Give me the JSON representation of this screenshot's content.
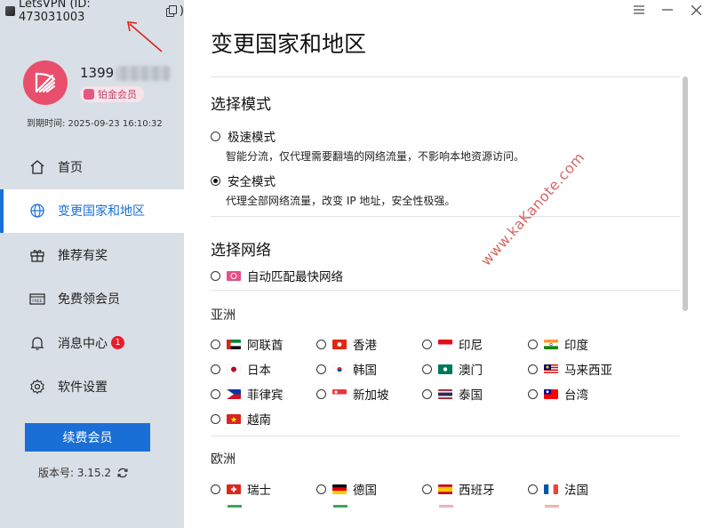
{
  "app": {
    "title": "LetsVPN (ID: 473031003",
    "title_suffix": ")"
  },
  "user": {
    "phone_visible": "1399",
    "badge": "铂金会员",
    "expire": "到期时间: 2025-09-23 16:10:32"
  },
  "nav": [
    {
      "label": "首页",
      "icon": "home-icon"
    },
    {
      "label": "变更国家和地区",
      "icon": "globe-icon",
      "active": true
    },
    {
      "label": "推荐有奖",
      "icon": "gift-icon"
    },
    {
      "label": "免费领会员",
      "icon": "free-ticket-icon"
    },
    {
      "label": "消息中心",
      "icon": "bell-icon",
      "badge": "1"
    },
    {
      "label": "软件设置",
      "icon": "gear-icon"
    }
  ],
  "renew_button": "续费会员",
  "version": "版本号:  3.15.2",
  "page_title": "变更国家和地区",
  "mode": {
    "title": "选择模式",
    "options": [
      {
        "label": "极速模式",
        "desc": "智能分流，仅代理需要翻墙的网络流量，不影响本地资源访问。",
        "checked": false
      },
      {
        "label": "安全模式",
        "desc": "代理全部网络流量，改变 IP 地址，安全性极强。",
        "checked": true
      }
    ]
  },
  "network": {
    "title": "选择网络",
    "auto": "自动匹配最快网络"
  },
  "regions": {
    "asia": "亚洲",
    "europe": "欧洲"
  },
  "asia_countries": [
    {
      "name": "阿联酋",
      "flag": "uae"
    },
    {
      "name": "香港",
      "flag": "hk"
    },
    {
      "name": "印尼",
      "flag": "id"
    },
    {
      "name": "印度",
      "flag": "in"
    },
    {
      "name": "日本",
      "flag": "jp"
    },
    {
      "name": "韩国",
      "flag": "kr"
    },
    {
      "name": "澳门",
      "flag": "mo"
    },
    {
      "name": "马来西亚",
      "flag": "my"
    },
    {
      "name": "菲律宾",
      "flag": "ph"
    },
    {
      "name": "新加坡",
      "flag": "sg"
    },
    {
      "name": "泰国",
      "flag": "th"
    },
    {
      "name": "台湾",
      "flag": "tw"
    },
    {
      "name": "越南",
      "flag": "vn"
    }
  ],
  "europe_countries": [
    {
      "name": "瑞士",
      "flag": "ch"
    },
    {
      "name": "德国",
      "flag": "de"
    },
    {
      "name": "西班牙",
      "flag": "es"
    },
    {
      "name": "法国",
      "flag": "fr"
    }
  ],
  "watermark": "www.kaKanote.com",
  "colors": {
    "accent": "#1a6fd6",
    "sidebar_bg": "#d9dfe6",
    "avatar": "#e94f6c",
    "badge_text": "#c2456b"
  }
}
